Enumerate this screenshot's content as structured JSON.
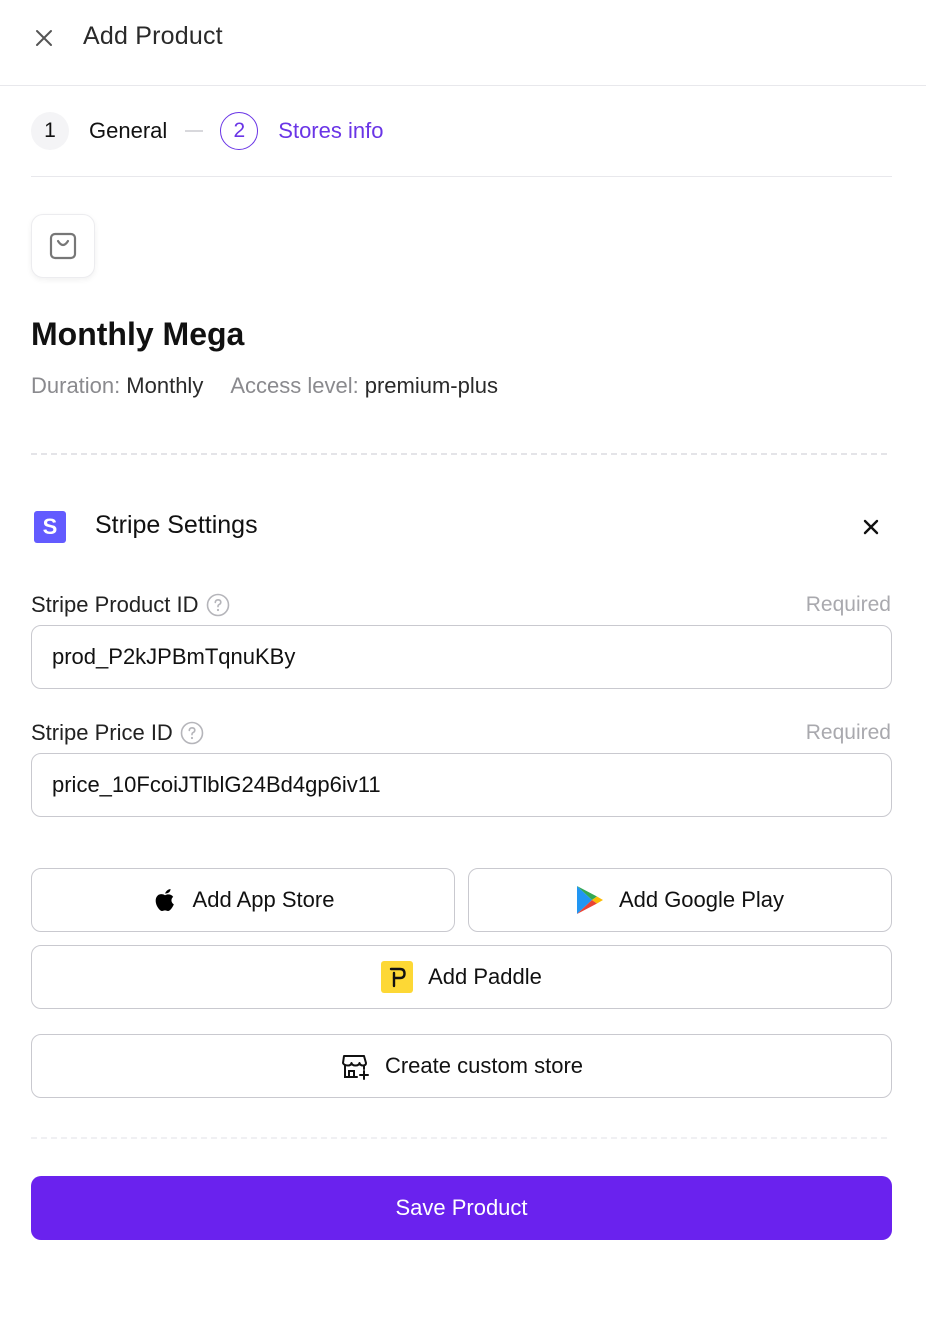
{
  "header": {
    "title": "Add Product",
    "close_icon": "close-icon"
  },
  "stepper": {
    "steps": [
      {
        "number": "1",
        "label": "General",
        "state": "done"
      },
      {
        "number": "2",
        "label": "Stores info",
        "state": "active"
      }
    ]
  },
  "product": {
    "icon": "shopping-bag-icon",
    "name": "Monthly Mega",
    "duration_label": "Duration:",
    "duration_value": "Monthly",
    "access_label": "Access level:",
    "access_value": "premium-plus"
  },
  "stripe": {
    "logo_letter": "S",
    "title": "Stripe Settings",
    "product_id_label": "Stripe Product ID",
    "product_id_required": "Required",
    "product_id_value": "prod_P2kJPBmTqnuKBy",
    "price_id_label": "Stripe Price ID",
    "price_id_required": "Required",
    "price_id_value": "price_10FcoiJTlblG24Bd4gp6iv11"
  },
  "stores": {
    "app_store_label": "Add App Store",
    "google_play_label": "Add Google Play",
    "paddle_label": "Add Paddle",
    "custom_store_label": "Create custom store"
  },
  "footer": {
    "save_label": "Save Product"
  },
  "colors": {
    "accent": "#6a22ee",
    "stepper_active": "#6a35e6",
    "stripe": "#635bff",
    "paddle": "#fdd835"
  }
}
